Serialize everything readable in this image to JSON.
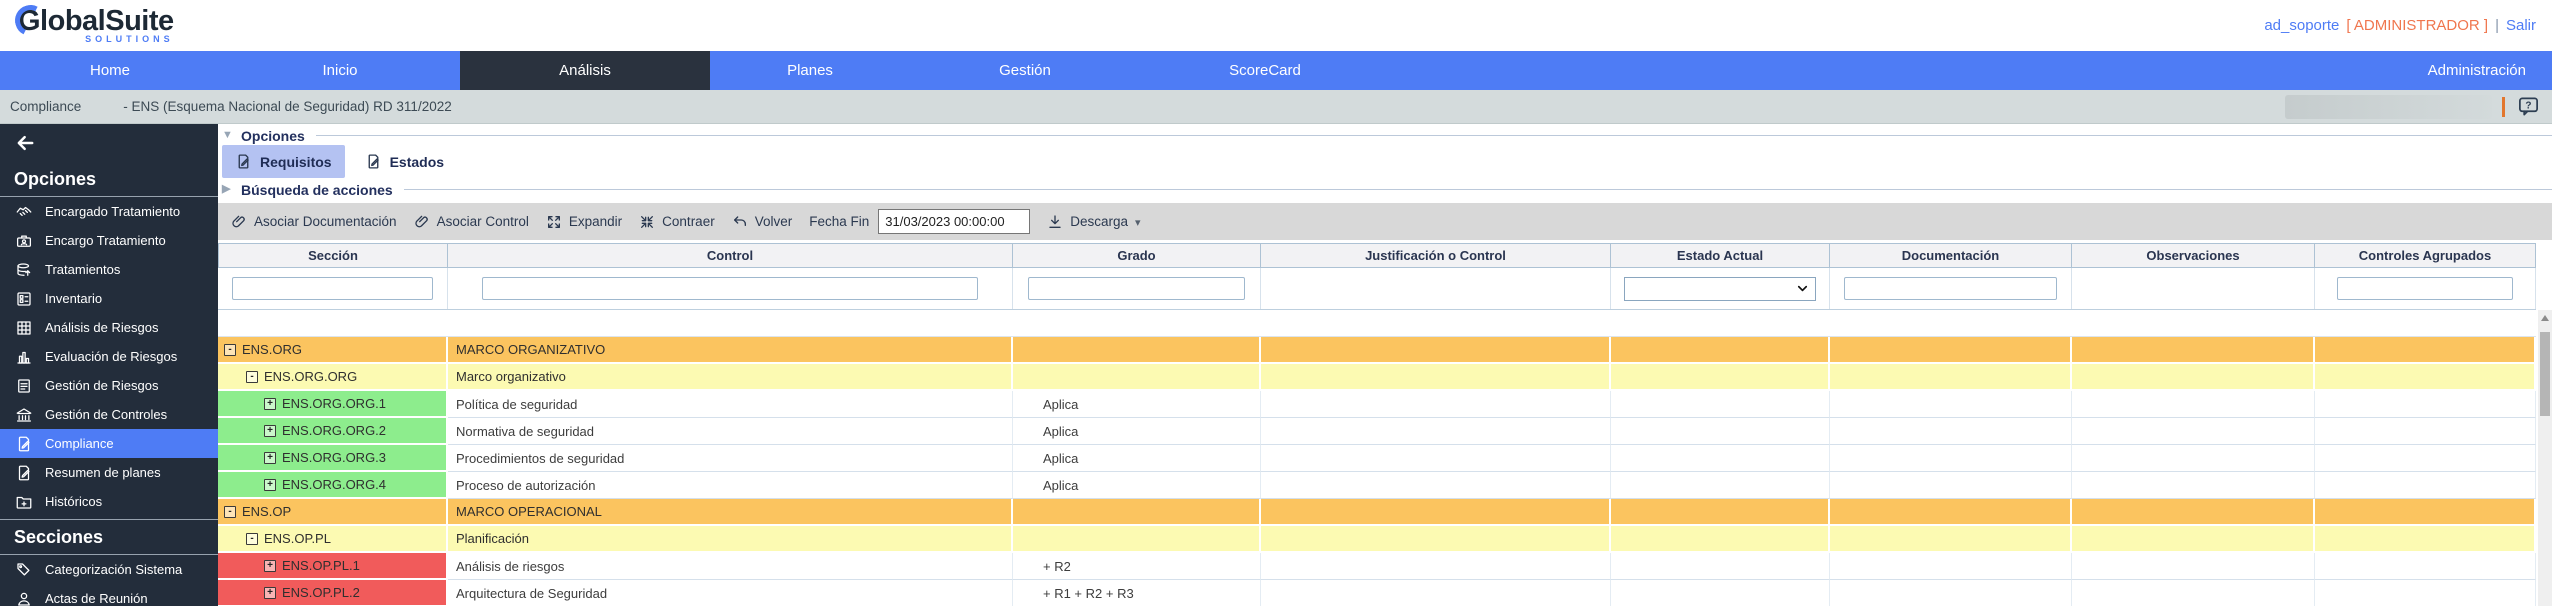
{
  "header": {
    "logo_text": "GlobalSuite",
    "logo_sub": "SOLUTIONS",
    "user": "ad_soporte",
    "role": "[ ADMINISTRADOR ]",
    "separator": "|",
    "logout": "Salir"
  },
  "nav": {
    "items": [
      {
        "label": "Home",
        "active": false
      },
      {
        "label": "Inicio",
        "active": false
      },
      {
        "label": "Análisis",
        "active": true
      },
      {
        "label": "Planes",
        "active": false
      },
      {
        "label": "Gestión",
        "active": false
      },
      {
        "label": "ScoreCard",
        "active": false
      }
    ],
    "right": "Administración"
  },
  "breadcrumb": {
    "section": "Compliance",
    "title": "- ENS (Esquema Nacional de Seguridad) RD 311/2022"
  },
  "sidebar": {
    "sections": [
      {
        "title": "Opciones",
        "items": [
          {
            "label": "Encargado Tratamiento",
            "icon": "handshake-icon",
            "active": false
          },
          {
            "label": "Encargo Tratamiento",
            "icon": "briefcase-user-icon",
            "active": false
          },
          {
            "label": "Tratamientos",
            "icon": "database-upload-icon",
            "active": false
          },
          {
            "label": "Inventario",
            "icon": "inventory-list-icon",
            "active": false
          },
          {
            "label": "Análisis de Riesgos",
            "icon": "grid-icon",
            "active": false
          },
          {
            "label": "Evaluación de Riesgos",
            "icon": "bar-chart-icon",
            "active": false
          },
          {
            "label": "Gestión de Riesgos",
            "icon": "document-lines-icon",
            "active": false
          },
          {
            "label": "Gestión de Controles",
            "icon": "bank-icon",
            "active": false
          },
          {
            "label": "Compliance",
            "icon": "document-edit-icon",
            "active": true
          },
          {
            "label": "Resumen de planes",
            "icon": "document-edit-icon",
            "active": false
          },
          {
            "label": "Históricos",
            "icon": "folder-plus-icon",
            "active": false
          }
        ]
      },
      {
        "title": "Secciones",
        "items": [
          {
            "label": "Categorización Sistema",
            "icon": "tags-icon",
            "active": false
          },
          {
            "label": "Actas de Reunión",
            "icon": "person-icon",
            "active": false
          }
        ]
      }
    ]
  },
  "content": {
    "panels": {
      "opciones": "Opciones",
      "busqueda": "Búsqueda de acciones"
    },
    "tabs": [
      {
        "label": "Requisitos",
        "selected": true
      },
      {
        "label": "Estados",
        "selected": false
      }
    ],
    "toolbar": {
      "buttons": [
        {
          "label": "Asociar Documentación",
          "icon": "paperclip-icon"
        },
        {
          "label": "Asociar Control",
          "icon": "paperclip-icon"
        },
        {
          "label": "Expandir",
          "icon": "expand-icon"
        },
        {
          "label": "Contraer",
          "icon": "collapse-icon"
        },
        {
          "label": "Volver",
          "icon": "undo-icon"
        }
      ],
      "fecha_fin_label": "Fecha Fin",
      "fecha_fin_value": "31/03/2023 00:00:00",
      "descarga_label": "Descarga",
      "descarga_icon": "download-icon"
    },
    "table": {
      "columns": [
        "Sección",
        "Control",
        "Grado",
        "Justificación o Control",
        "Estado Actual",
        "Documentación",
        "Observaciones",
        "Controles Agrupados"
      ],
      "filters": [
        {
          "column": "Sección",
          "control": "input",
          "value": ""
        },
        {
          "column": "Control",
          "control": "input",
          "value": ""
        },
        {
          "column": "Grado",
          "control": "input",
          "value": ""
        },
        {
          "column": "Justificación o Control",
          "control": "none",
          "value": ""
        },
        {
          "column": "Estado Actual",
          "control": "select",
          "value": ""
        },
        {
          "column": "Documentación",
          "control": "input",
          "value": ""
        },
        {
          "column": "Observaciones",
          "control": "none",
          "value": ""
        },
        {
          "column": "Controles Agrupados",
          "control": "input-narrow",
          "value": ""
        }
      ],
      "status_colors": {
        "orange": "#FBC45F",
        "yellow": "#FCFAB2",
        "green": "#8DED8D",
        "red": "#F15B5B"
      },
      "rows": [
        {
          "seccion": "ENS.ORG",
          "control": "MARCO ORGANIZATIVO",
          "grado": "",
          "level": 0,
          "color": "orange",
          "full_row": true,
          "toggle": "-"
        },
        {
          "seccion": "ENS.ORG.ORG",
          "control": "Marco organizativo",
          "grado": "",
          "level": 1,
          "color": "yellow",
          "full_row": true,
          "toggle": "-"
        },
        {
          "seccion": "ENS.ORG.ORG.1",
          "control": "Política de seguridad",
          "grado": "Aplica",
          "level": 2,
          "color": "green",
          "full_row": false,
          "toggle": "+"
        },
        {
          "seccion": "ENS.ORG.ORG.2",
          "control": "Normativa de seguridad",
          "grado": "Aplica",
          "level": 2,
          "color": "green",
          "full_row": false,
          "toggle": "+"
        },
        {
          "seccion": "ENS.ORG.ORG.3",
          "control": "Procedimientos de seguridad",
          "grado": "Aplica",
          "level": 2,
          "color": "green",
          "full_row": false,
          "toggle": "+"
        },
        {
          "seccion": "ENS.ORG.ORG.4",
          "control": "Proceso de autorización",
          "grado": "Aplica",
          "level": 2,
          "color": "green",
          "full_row": false,
          "toggle": "+"
        },
        {
          "seccion": "ENS.OP",
          "control": "MARCO OPERACIONAL",
          "grado": "",
          "level": 0,
          "color": "orange",
          "full_row": true,
          "toggle": "-"
        },
        {
          "seccion": "ENS.OP.PL",
          "control": "Planificación",
          "grado": "",
          "level": 1,
          "color": "yellow",
          "full_row": true,
          "toggle": "-"
        },
        {
          "seccion": "ENS.OP.PL.1",
          "control": "Análisis de riesgos",
          "grado": "+ R2",
          "level": 2,
          "color": "red",
          "full_row": false,
          "toggle": "+"
        },
        {
          "seccion": "ENS.OP.PL.2",
          "control": "Arquitectura de Seguridad",
          "grado": "+ R1 + R2 + R3",
          "level": 2,
          "color": "red",
          "full_row": false,
          "toggle": "+"
        }
      ]
    }
  }
}
